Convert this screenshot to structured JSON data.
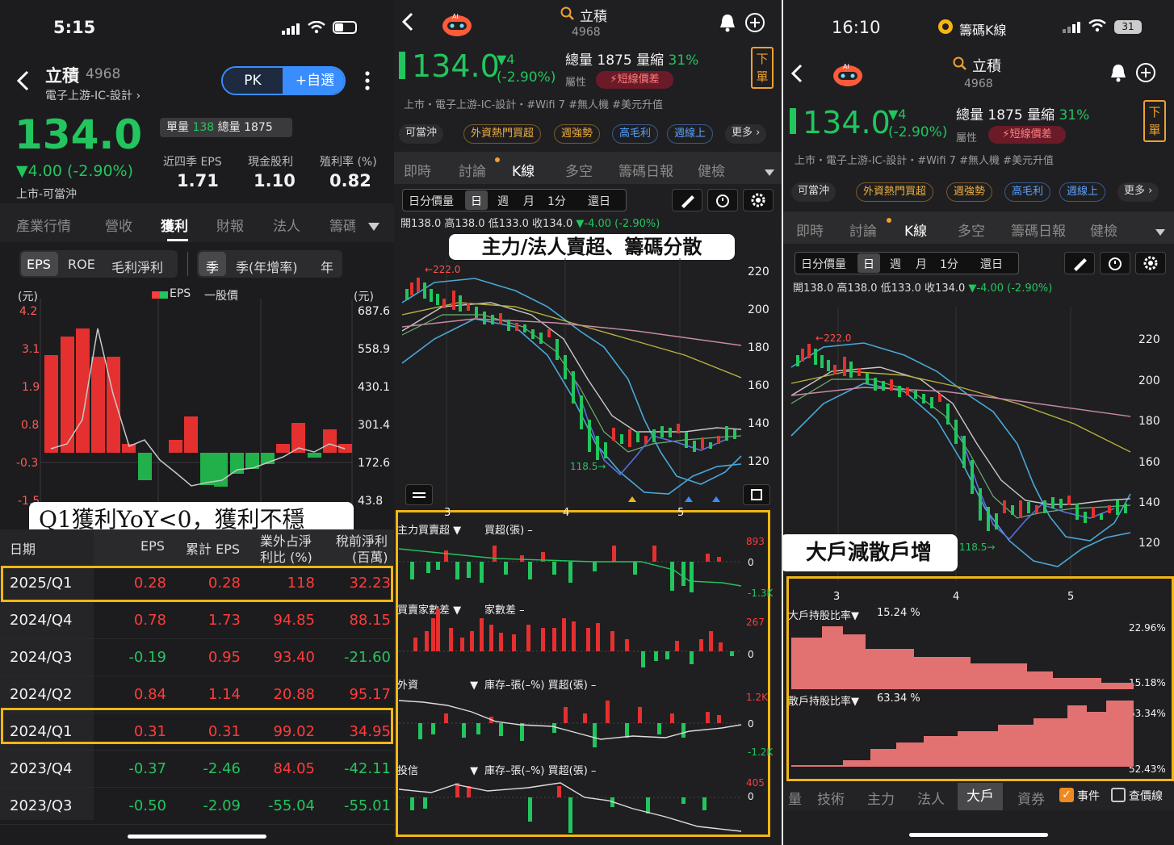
{
  "p1": {
    "time": "5:15",
    "stock_name": "立積",
    "stock_code": "4968",
    "industry": "電子上游-IC-設計",
    "pk_label": "PK",
    "watch_label": "+自選",
    "price": "134.0",
    "change": "▼4.00 (-2.90%)",
    "market": "上市-可當沖",
    "vol_label": "單量",
    "vol_value": "138",
    "total_label": "總量",
    "total_value": "1875",
    "metrics": [
      {
        "label": "近四季 EPS",
        "value": "1.71"
      },
      {
        "label": "現金股利",
        "value": "1.10"
      },
      {
        "label": "殖利率 (%)",
        "value": "0.82"
      }
    ],
    "tabs": [
      "產業行情",
      "營收",
      "獲利",
      "財報",
      "法人",
      "籌碼"
    ],
    "active_tab": "獲利",
    "subtabs": [
      "EPS",
      "ROE",
      "毛利淨利"
    ],
    "period_tabs": [
      "季",
      "季(年增率)",
      "年"
    ],
    "chart_unit_left": "(元)",
    "chart_unit_right": "(元)",
    "legend_eps": "EPS",
    "legend_price": "一股價",
    "yticks_left": [
      "4.2",
      "3.1",
      "1.9",
      "0.8",
      "-0.3",
      "-1.5"
    ],
    "yticks_right": [
      "687.6",
      "558.9",
      "430.1",
      "301.4",
      "172.6",
      "43.8"
    ],
    "note": "Q1獲利YoY<0，獲利不穩",
    "table_headers": [
      "日期",
      "EPS",
      "累計 EPS",
      "業外占淨利比 (%)",
      "稅前淨利 (百萬)"
    ],
    "header_line1_col3": "業外占淨",
    "header_line2_col3": "利比 (%)",
    "header_line1_col4": "稅前淨利",
    "header_line2_col4": "(百萬)",
    "rows": [
      {
        "date": "2025/Q1",
        "eps": "0.28",
        "cum": "0.28",
        "ratio": "118",
        "pretax": "32.23"
      },
      {
        "date": "2024/Q4",
        "eps": "0.78",
        "cum": "1.73",
        "ratio": "94.85",
        "pretax": "88.15"
      },
      {
        "date": "2024/Q3",
        "eps": "-0.19",
        "cum": "0.95",
        "ratio": "93.40",
        "pretax": "-21.60"
      },
      {
        "date": "2024/Q2",
        "eps": "0.84",
        "cum": "1.14",
        "ratio": "20.88",
        "pretax": "95.17"
      },
      {
        "date": "2024/Q1",
        "eps": "0.31",
        "cum": "0.31",
        "ratio": "99.02",
        "pretax": "34.95"
      },
      {
        "date": "2023/Q4",
        "eps": "-0.37",
        "cum": "-2.46",
        "ratio": "84.05",
        "pretax": "-42.11"
      },
      {
        "date": "2023/Q3",
        "eps": "-0.50",
        "cum": "-2.09",
        "ratio": "-55.04",
        "pretax": "-55.01"
      }
    ]
  },
  "p2": {
    "search_title": "立積",
    "code": "4968",
    "price": "134.0",
    "chg1": "▼4",
    "chg2": "(-2.90%)",
    "total_label": "總量",
    "total_value": "1875",
    "shrink_label": "量縮",
    "shrink_value": "31%",
    "attr_label": "屬性",
    "attr_badge": "短線價差",
    "order_btn": "下單",
    "tags": "上市・電子上游-IC-設計・#Wifi 7 #無人機 #美元升值",
    "chips": [
      "可當沖",
      "外資熱門買超",
      "週強勢",
      "高毛利",
      "週線上",
      "更多 ›"
    ],
    "tabs": [
      "即時",
      "討論",
      "K線",
      "多空",
      "籌碼日報",
      "健檢"
    ],
    "active_tab": "K線",
    "ktype": "日分價量",
    "periods": [
      "日",
      "週",
      "月",
      "1分",
      "還日"
    ],
    "ohlc": "開138.0 高138.0 低133.0 收134.0",
    "ohlc_chg": "▼-4.00 (-2.90%)",
    "note": "主力/法人賣超、籌碼分散",
    "high_label": "222.0",
    "low_label": "118.5",
    "price_ticks": [
      "220",
      "200",
      "180",
      "160",
      "140",
      "120"
    ],
    "x_labels": [
      "3",
      "4",
      "5"
    ],
    "ind1_name": "主力買賣超",
    "ind1_val": "買超(張) –",
    "ind1_max": "893",
    "ind1_zero": "0",
    "ind1_min": "-1.3K",
    "ind2_name": "買賣家數差",
    "ind2_val": "家數差 –",
    "ind2_max": "267",
    "ind2_zero": "0",
    "ind3_name": "外資",
    "ind3_val": "庫存–張(–%) 買超(張) –",
    "ind3_max": "1.2K",
    "ind3_zero": "0",
    "ind3_min": "-1.2K",
    "ind4_name": "投信",
    "ind4_val": "庫存–張(–%) 買超(張) –",
    "ind4_max": "405",
    "ind4_zero": "0"
  },
  "p3": {
    "time": "16:10",
    "app_title": "籌碼K線",
    "battery": "31",
    "search_title": "立積",
    "code": "4968",
    "price": "134.0",
    "chg1": "▼4",
    "chg2": "(-2.90%)",
    "total_label": "總量",
    "total_value": "1875",
    "shrink_label": "量縮",
    "shrink_value": "31%",
    "attr_label": "屬性",
    "attr_badge": "短線價差",
    "order_btn": "下單",
    "tags": "上市・電子上游-IC-設計・#Wifi 7 #無人機 #美元升值",
    "chips": [
      "可當沖",
      "外資熱門買超",
      "週強勢",
      "高毛利",
      "週線上",
      "更多 ›"
    ],
    "tabs": [
      "即時",
      "討論",
      "K線",
      "多空",
      "籌碼日報",
      "健檢"
    ],
    "ktype": "日分價量",
    "periods": [
      "日",
      "週",
      "月",
      "1分",
      "還日"
    ],
    "ohlc": "開138.0 高138.0 低133.0 收134.0",
    "ohlc_chg": "▼-4.00 (-2.90%)",
    "note": "大戶減散戶增",
    "high_label": "222.0",
    "low_label": "118.5",
    "price_ticks": [
      "220",
      "200",
      "180",
      "160",
      "140",
      "120"
    ],
    "x_labels": [
      "3",
      "4",
      "5"
    ],
    "big_name": "大戶持股比率",
    "big_val": "15.24 %",
    "big_max": "22.96%",
    "big_min": "15.18%",
    "retail_name": "散戶持股比率",
    "retail_val": "63.34 %",
    "retail_max": "63.34%",
    "retail_min": "52.43%",
    "bottom_tabs": [
      "量",
      "技術",
      "主力",
      "法人",
      "大戶",
      "資券"
    ],
    "active_bottom": "大戶",
    "event_label": "事件",
    "price_line_label": "查價線"
  },
  "colors": {
    "accent_yellow": "#f2b614",
    "up_red": "#ff3b3b",
    "down_green": "#22c55e",
    "blue": "#3a8dff"
  }
}
